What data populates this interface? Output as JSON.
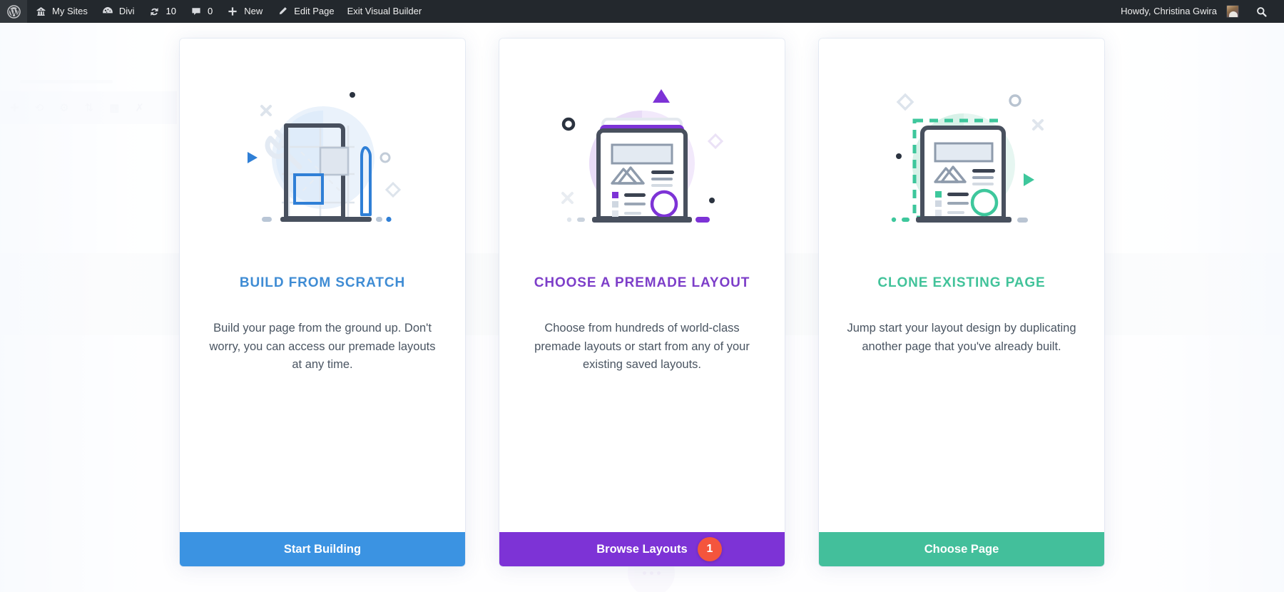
{
  "adminbar": {
    "left_items": [
      {
        "id": "wp-logo",
        "icon": "wordpress-icon",
        "label": ""
      },
      {
        "id": "my-sites",
        "icon": "sites-icon",
        "label": "My Sites"
      },
      {
        "id": "divi",
        "icon": "divi-icon",
        "label": "Divi"
      },
      {
        "id": "updates",
        "icon": "updates-icon",
        "label": "10"
      },
      {
        "id": "comments",
        "icon": "comment-icon",
        "label": "0"
      },
      {
        "id": "new",
        "icon": "plus-icon",
        "label": "New"
      },
      {
        "id": "edit-page",
        "icon": "pencil-icon",
        "label": "Edit Page"
      },
      {
        "id": "exit-vb",
        "icon": "",
        "label": "Exit Visual Builder"
      }
    ],
    "howdy": "Howdy, Christina Gwira",
    "search_icon": "search-icon"
  },
  "cards": [
    {
      "id": "build-from-scratch",
      "title": "BUILD FROM SCRATCH",
      "title_color": "#3f8cd4",
      "description": "Build your page from the ground up. Don't worry, you can access our premade layouts at any time.",
      "button_label": "Start Building",
      "button_color": "#3b93e2",
      "badge": null,
      "art": "wireframe-grid-illustration"
    },
    {
      "id": "choose-premade-layout",
      "title": "CHOOSE A PREMADE LAYOUT",
      "title_color": "#7d3ec9",
      "description": "Choose from hundreds of world-class premade layouts or start from any of your existing saved layouts.",
      "button_label": "Browse Layouts",
      "button_color": "#7d33d6",
      "badge": "1",
      "badge_color": "#f4553d",
      "art": "premade-layout-illustration"
    },
    {
      "id": "clone-existing-page",
      "title": "CLONE EXISTING PAGE",
      "title_color": "#42c39a",
      "description": "Jump start your layout design by duplicating another page that you've already built.",
      "button_label": "Choose Page",
      "button_color": "#43bf9b",
      "badge": null,
      "art": "clone-page-illustration"
    }
  ],
  "background": {
    "toolbar_icons": [
      "plus-icon",
      "duplicate-icon",
      "settings-icon",
      "move-icon",
      "columns-icon",
      "trash-icon"
    ]
  }
}
